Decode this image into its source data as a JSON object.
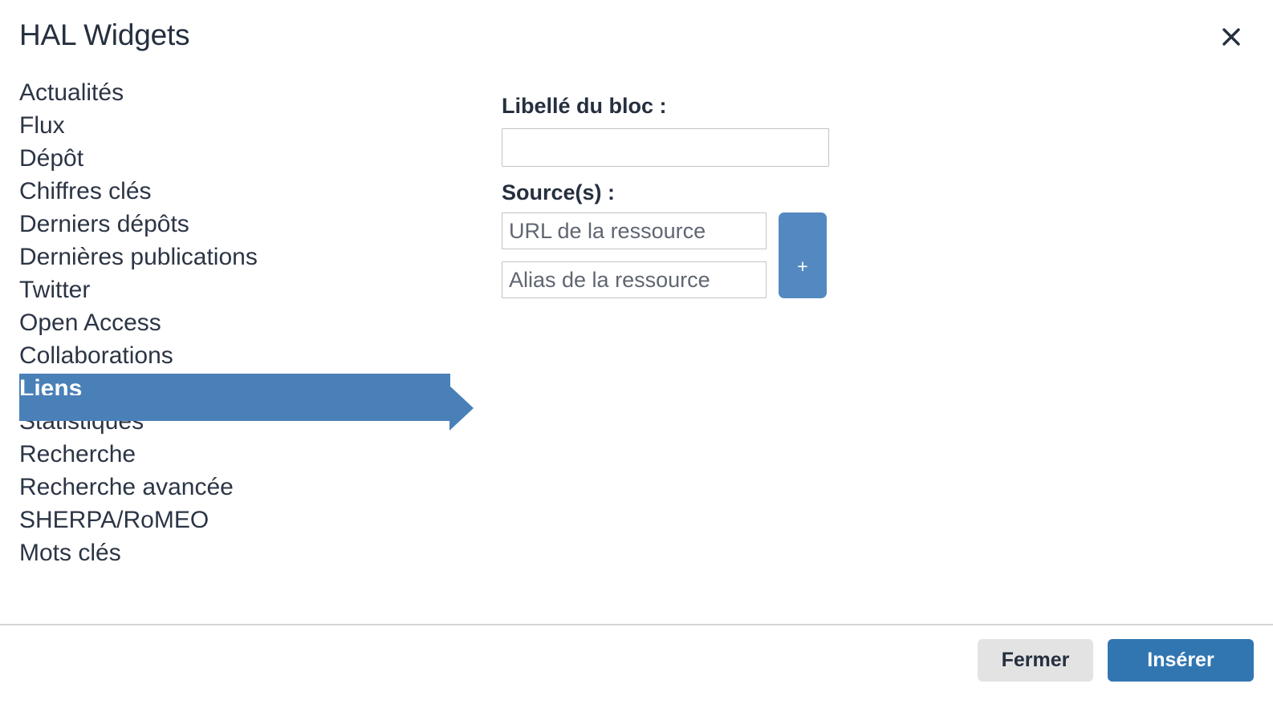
{
  "dialog": {
    "title": "HAL Widgets",
    "close_icon": "close-icon"
  },
  "widget_list": {
    "items": [
      {
        "label": "Actualités",
        "selected": false
      },
      {
        "label": "Flux",
        "selected": false
      },
      {
        "label": "Dépôt",
        "selected": false
      },
      {
        "label": "Chiffres clés",
        "selected": false
      },
      {
        "label": "Derniers dépôts",
        "selected": false
      },
      {
        "label": "Dernières publications",
        "selected": false
      },
      {
        "label": "Twitter",
        "selected": false
      },
      {
        "label": "Open Access",
        "selected": false
      },
      {
        "label": "Collaborations",
        "selected": false
      },
      {
        "label": "Liens",
        "selected": true
      },
      {
        "label": "Statistiques",
        "selected": false
      },
      {
        "label": "Recherche",
        "selected": false
      },
      {
        "label": "Recherche avancée",
        "selected": false
      },
      {
        "label": "SHERPA/RoMEO",
        "selected": false
      },
      {
        "label": "Mots clés",
        "selected": false
      }
    ]
  },
  "annotation": {
    "arrow_icon": "right-arrow-annotation-icon",
    "color": "#4a80b8",
    "points_to": "Liens"
  },
  "form": {
    "bloc_label": "Libellé du bloc :",
    "bloc_value": "",
    "bloc_placeholder": "",
    "sources_label": "Source(s) :",
    "url_value": "",
    "url_placeholder": "URL de la ressource",
    "alias_value": "",
    "alias_placeholder": "Alias de la ressource",
    "add_button_label": "+"
  },
  "footer": {
    "close_label": "Fermer",
    "insert_label": "Insérer"
  },
  "colors": {
    "accent_blue": "#3276b1",
    "selection_blue": "#4a80b8",
    "add_button_blue": "#5389c0",
    "text_dark": "#252f3e",
    "secondary_grey": "#e3e3e3",
    "border_grey": "#c4c4c4"
  }
}
